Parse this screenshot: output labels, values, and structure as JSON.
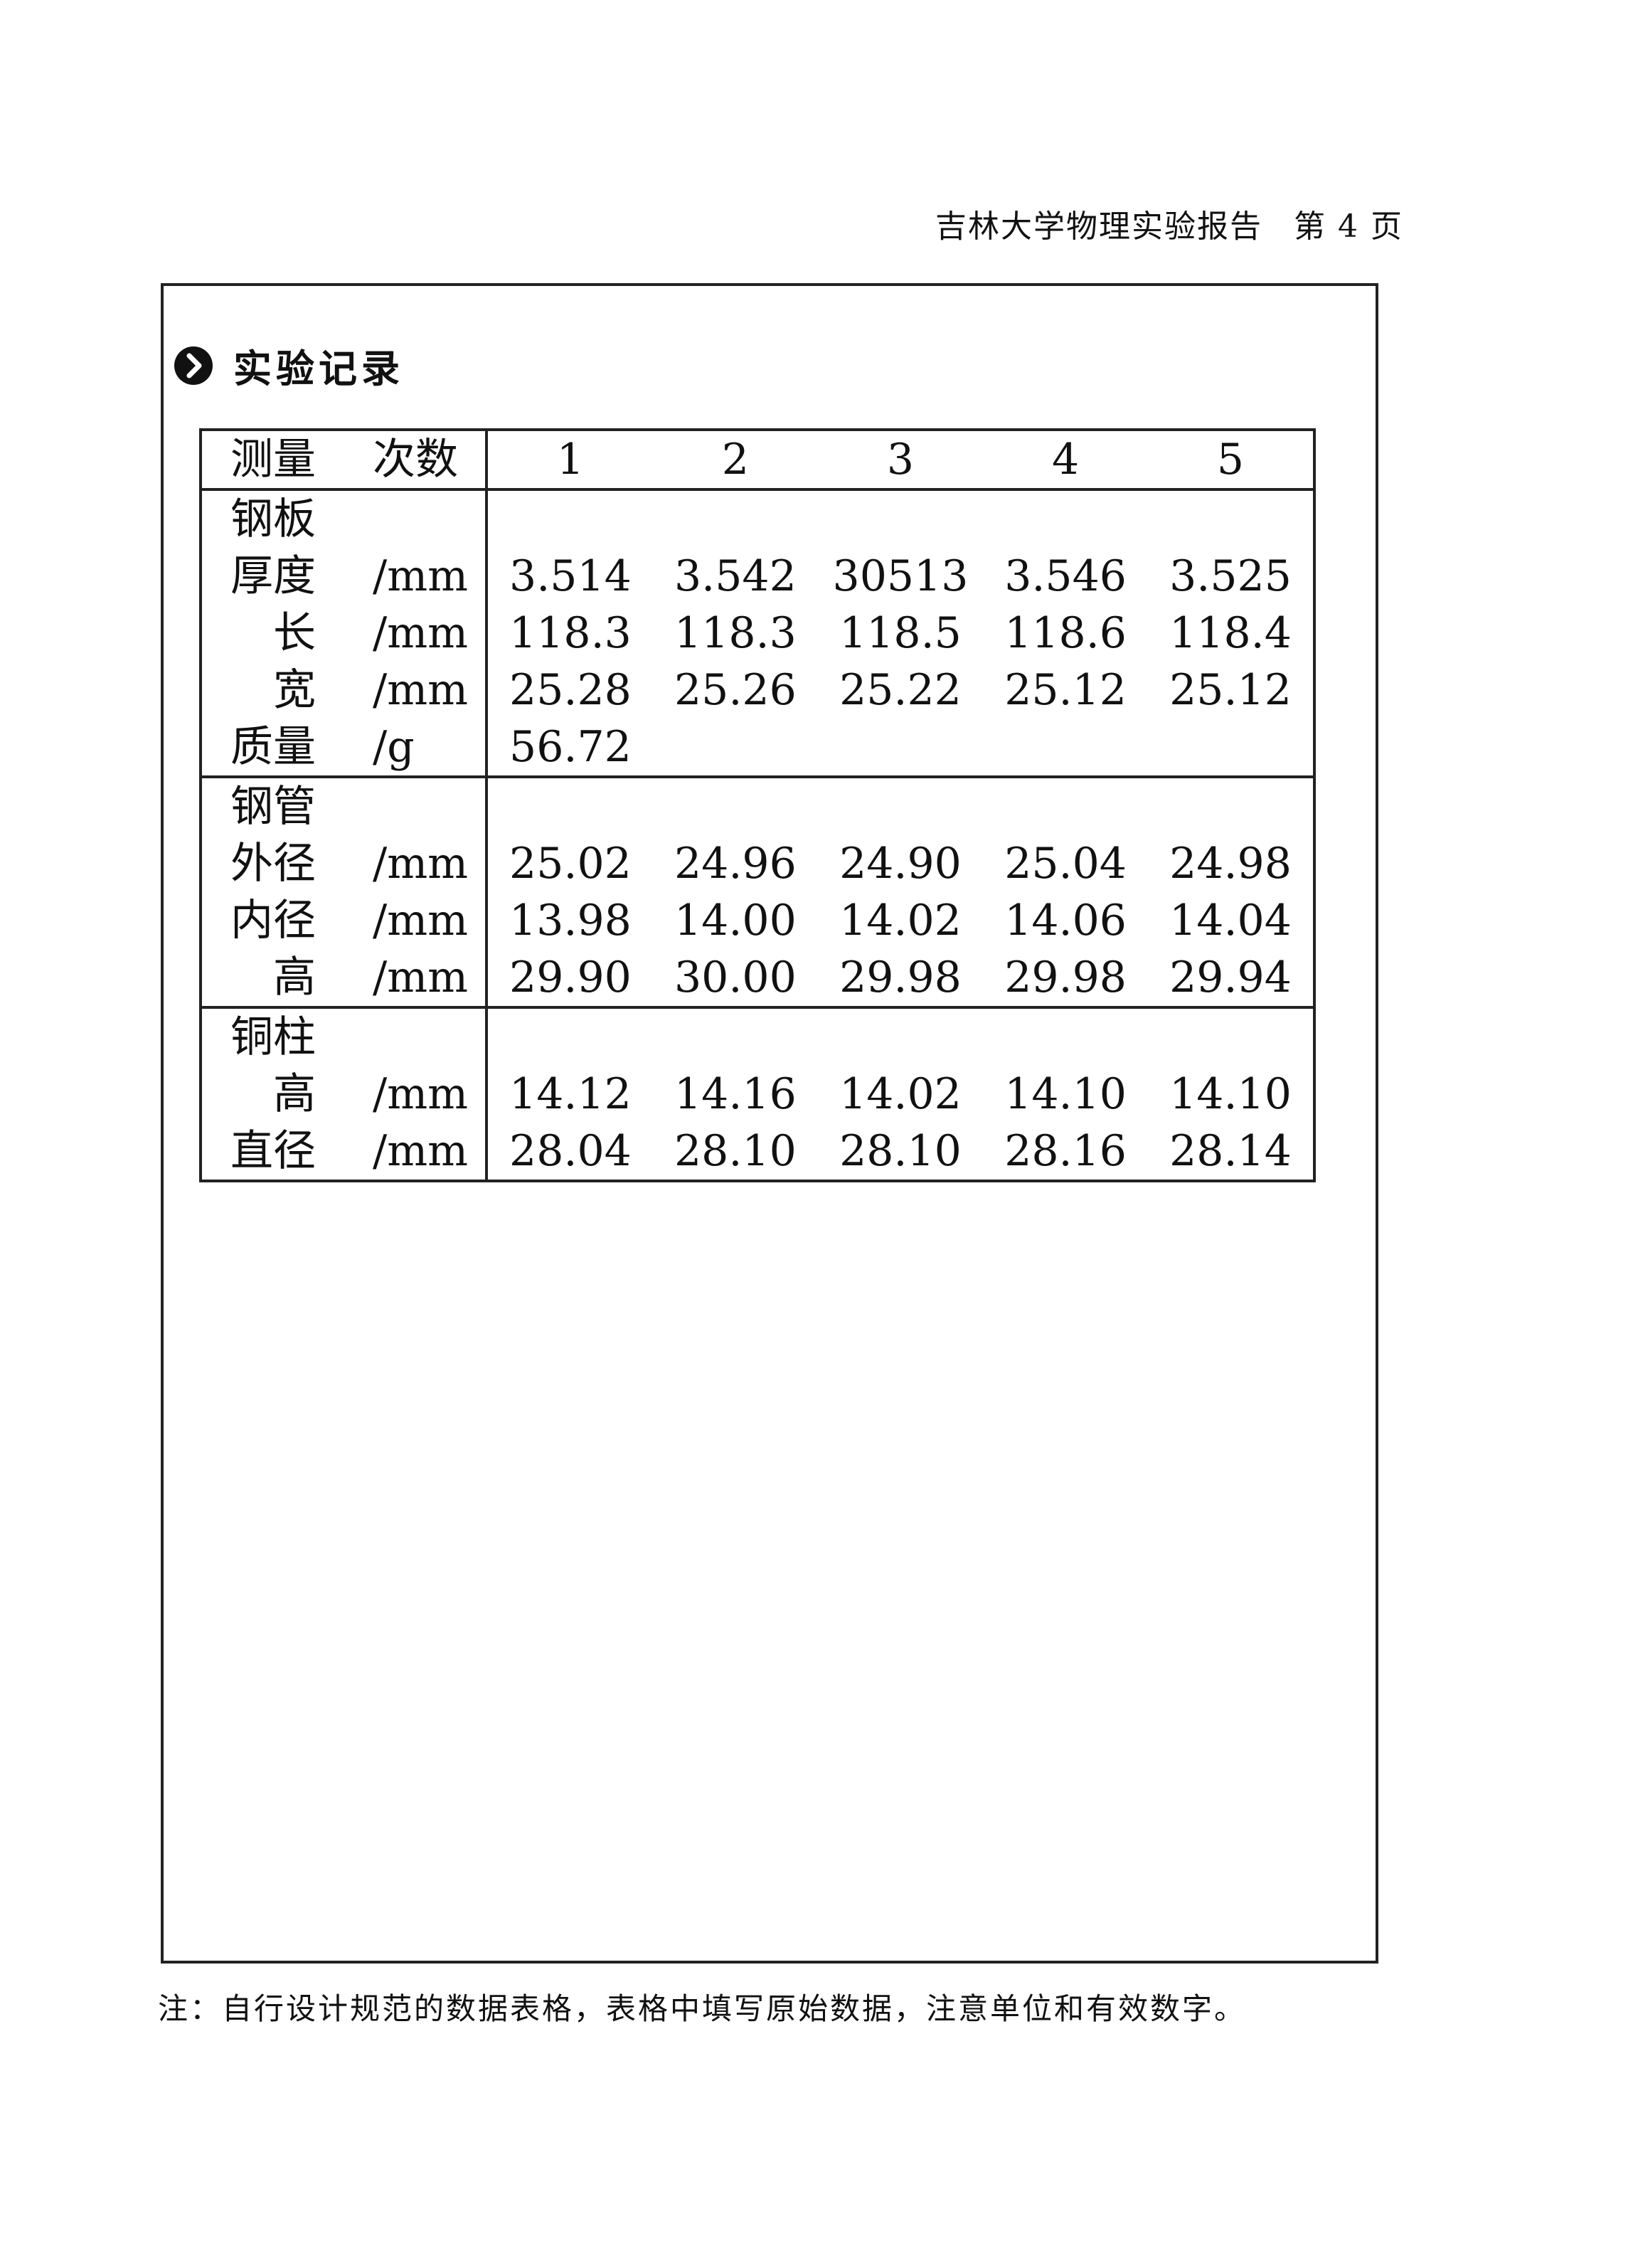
{
  "header": {
    "title": "吉林大学物理实验报告",
    "page": "第 4 页"
  },
  "section": {
    "title": "实验记录",
    "icon": "chevron-right-circle-icon"
  },
  "table": {
    "header": {
      "label_a": "测量",
      "label_b": "次数",
      "trials": [
        "1",
        "2",
        "3",
        "4",
        "5"
      ]
    },
    "groups": [
      {
        "name": "钢板",
        "rows": [
          {
            "label": "厚度",
            "unit": "/mm",
            "values": [
              "3.514",
              "3.542",
              "30513",
              "3.546",
              "3.525"
            ]
          },
          {
            "label": "长",
            "unit": "/mm",
            "values": [
              "118.3",
              "118.3",
              "118.5",
              "118.6",
              "118.4"
            ]
          },
          {
            "label": "宽",
            "unit": "/mm",
            "values": [
              "25.28",
              "25.26",
              "25.22",
              "25.12",
              "25.12"
            ]
          },
          {
            "label": "质量",
            "unit": "/g",
            "values": [
              "56.72",
              "",
              "",
              "",
              ""
            ]
          }
        ]
      },
      {
        "name": "钢管",
        "rows": [
          {
            "label": "外径",
            "unit": "/mm",
            "values": [
              "25.02",
              "24.96",
              "24.90",
              "25.04",
              "24.98"
            ]
          },
          {
            "label": "内径",
            "unit": "/mm",
            "values": [
              "13.98",
              "14.00",
              "14.02",
              "14.06",
              "14.04"
            ]
          },
          {
            "label": "高",
            "unit": "/mm",
            "values": [
              "29.90",
              "30.00",
              "29.98",
              "29.98",
              "29.94"
            ]
          }
        ]
      },
      {
        "name": "铜柱",
        "rows": [
          {
            "label": "高",
            "unit": "/mm",
            "values": [
              "14.12",
              "14.16",
              "14.02",
              "14.10",
              "14.10"
            ]
          },
          {
            "label": "直径",
            "unit": "/mm",
            "values": [
              "28.04",
              "28.10",
              "28.10",
              "28.16",
              "28.14"
            ]
          }
        ]
      }
    ]
  },
  "footnote": "注：自行设计规范的数据表格，表格中填写原始数据，注意单位和有效数字。"
}
